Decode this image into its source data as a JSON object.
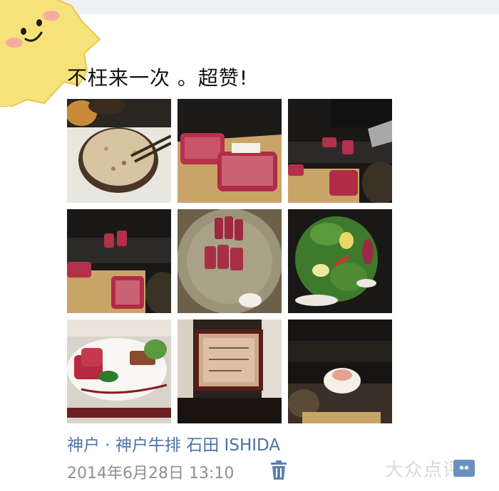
{
  "post": {
    "text": "不枉来一次 。超赞!",
    "location": "神户 · 神户牛排 石田 ISHIDA",
    "timestamp": "2014年6月28日 13:10",
    "more_label": "••"
  },
  "icons": {
    "avatar": "star-smiley-icon",
    "delete": "trash-icon",
    "more": "more-icon"
  },
  "photos": [
    {
      "subject": "fried rice bowl"
    },
    {
      "subject": "raw wagyu beef slabs"
    },
    {
      "subject": "chef at teppanyaki grill"
    },
    {
      "subject": "beef on teppanyaki grill"
    },
    {
      "subject": "sliced steak on plate"
    },
    {
      "subject": "green salad"
    },
    {
      "subject": "beef appetizer plate"
    },
    {
      "subject": "restaurant plaque"
    },
    {
      "subject": "dessert on grill"
    }
  ],
  "watermark": "大众点评",
  "colors": {
    "link_blue": "#4a73a8",
    "timestamp_gray": "#8f8f8f",
    "text_black": "#111111",
    "avatar_yellow": "#f5dc6e"
  }
}
